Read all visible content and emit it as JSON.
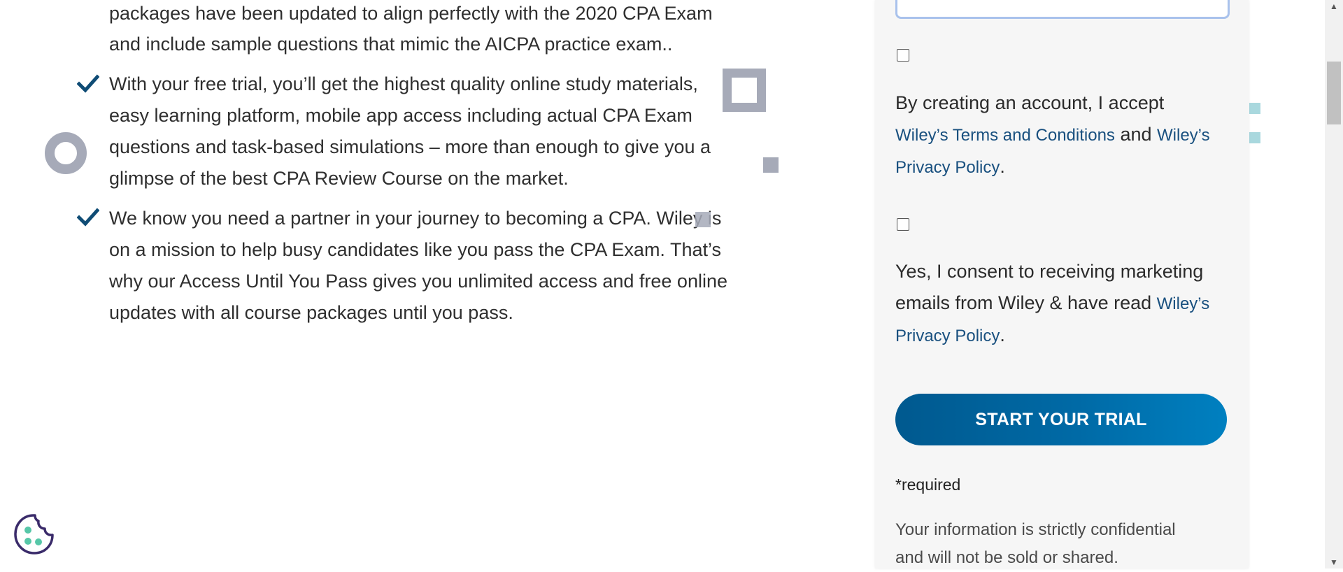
{
  "benefits": {
    "item1_lines": [
      "packages have been updated to align perfectly with the 2020 CPA Exam",
      "and include sample questions that mimic the AICPA practice exam.."
    ],
    "item2_lines": [
      "With your free trial, you’ll get the highest quality online study materials,",
      "easy learning platform, mobile app access including actual CPA Exam",
      "questions and task-based simulations – more than enough to give you a",
      "glimpse of the best CPA Review Course on the market."
    ],
    "item3_lines": [
      "We know you need a partner in your journey to becoming a CPA. Wiley is",
      "on a mission to help busy candidates like you pass the CPA Exam. That’s",
      "why our Access Until You Pass gives you unlimited access and free online",
      "updates with all course packages until you pass."
    ]
  },
  "form": {
    "input_value": "",
    "terms": {
      "line1": "By creating an account, I accept",
      "link_terms": "Wiley’s Terms and Conditions",
      "and": "and",
      "link_privacy_1": "Wiley’s",
      "link_privacy_2": "Privacy Policy",
      "period": "."
    },
    "marketing": {
      "line1": "Yes, I consent to receiving marketing",
      "line2": "emails from Wiley & have read",
      "link_privacy_1": "Wiley’s",
      "link_privacy_2": "Privacy Policy",
      "period": "."
    },
    "cta_label": "START YOUR TRIAL",
    "required_note": "*required",
    "confidential_lines": [
      "Your information is strictly confidential",
      "and will not be sold or shared."
    ]
  },
  "colors": {
    "check": "#0f4c75",
    "link": "#19507f",
    "cta_start": "#00598f",
    "cta_end": "#0080c0",
    "cookie_outline": "#3a2b6a",
    "cookie_dots": "#57c7a8"
  },
  "icons": {
    "check": "checkmark-icon",
    "cookie": "cookie-icon",
    "scroll_up": "scroll-up-arrow-icon",
    "scroll_down": "scroll-down-arrow-icon"
  }
}
